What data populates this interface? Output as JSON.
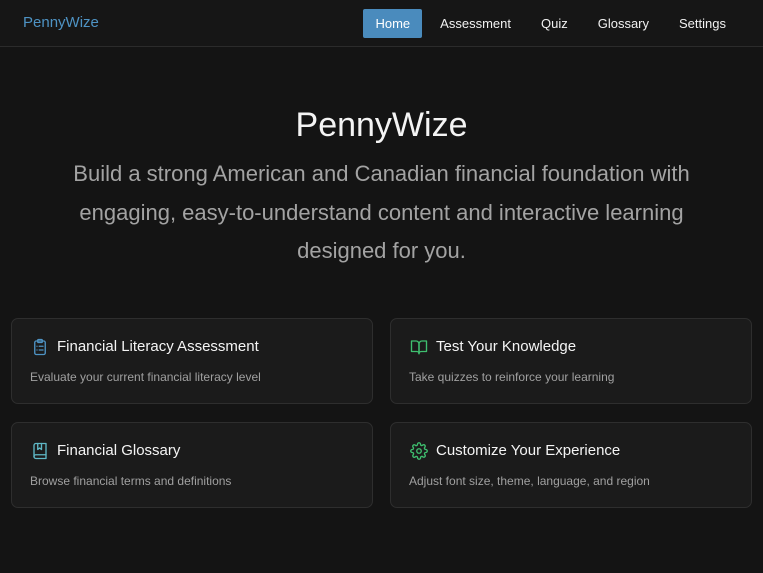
{
  "brand": {
    "name": "PennyWize",
    "color": "#4e93c4"
  },
  "nav": {
    "items": [
      {
        "label": "Home",
        "active": true
      },
      {
        "label": "Assessment",
        "active": false
      },
      {
        "label": "Quiz",
        "active": false
      },
      {
        "label": "Glossary",
        "active": false
      },
      {
        "label": "Settings",
        "active": false
      }
    ],
    "active_color": "#4a8bbd"
  },
  "hero": {
    "title": "PennyWize",
    "subtitle": "Build a strong American and Canadian financial foundation with engaging, easy-to-understand content and interactive learning designed for you."
  },
  "cards": [
    {
      "title": "Financial Literacy Assessment",
      "description": "Evaluate your current financial literacy level",
      "icon": "clipboard-list-icon",
      "icon_color": "#4e93c4"
    },
    {
      "title": "Test Your Knowledge",
      "description": "Take quizzes to reinforce your learning",
      "icon": "book-open-icon",
      "icon_color": "#3fbf6f"
    },
    {
      "title": "Financial Glossary",
      "description": "Browse financial terms and definitions",
      "icon": "bookmark-book-icon",
      "icon_color": "#5fb8c6"
    },
    {
      "title": "Customize Your Experience",
      "description": "Adjust font size, theme, language, and region",
      "icon": "gear-icon",
      "icon_color": "#3fbf6f"
    }
  ]
}
